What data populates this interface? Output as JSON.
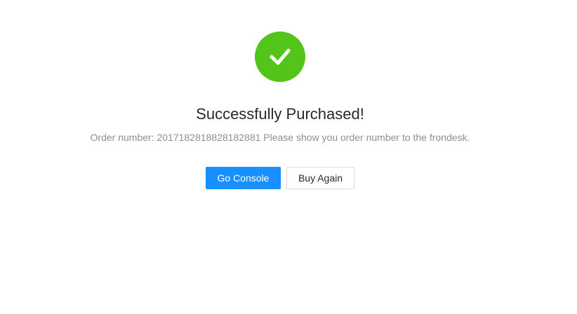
{
  "result": {
    "status": "success",
    "status_color": "#52c41a",
    "icon": "check-circle-icon",
    "title": "Successfully Purchased!",
    "subtitle": "Order number: 2017182818828182881 Please show you order number to the frondesk."
  },
  "actions": {
    "primary_label": "Go Console",
    "primary_color": "#1890ff",
    "secondary_label": "Buy Again"
  }
}
